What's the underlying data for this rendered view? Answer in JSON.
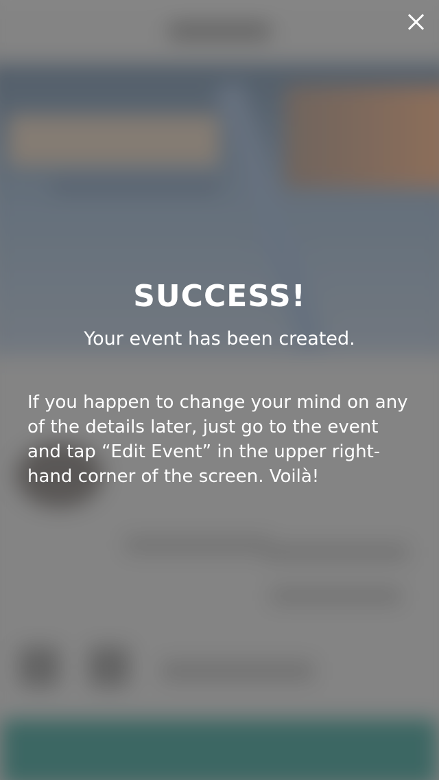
{
  "modal": {
    "headline": "SUCCESS!",
    "subheadline": "Your event has been created.",
    "body": "If you happen to change your mind on any of the details later, just go to the event and tap “Edit Event” in the upper right-hand corner of the screen. Voilà!",
    "close_icon": "close-icon"
  },
  "colors": {
    "text": "#ffffff",
    "overlay": "#7d7d7d",
    "background_cta": "#1d5e58"
  }
}
